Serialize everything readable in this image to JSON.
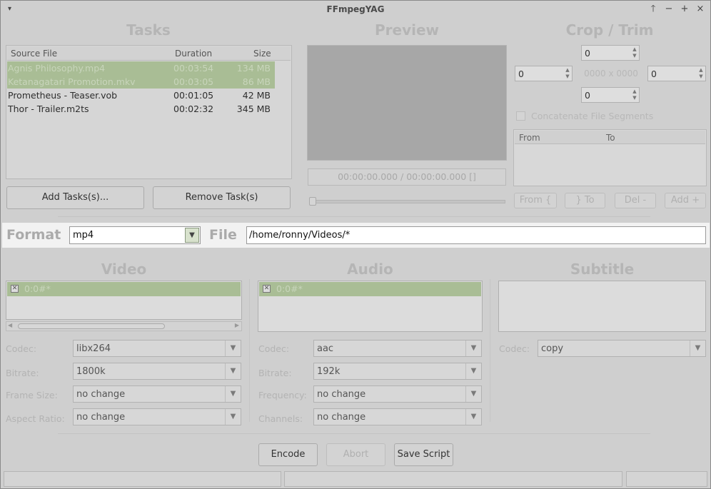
{
  "window": {
    "title": "FFmpegYAG",
    "menu_glyph": "▾",
    "buttons": [
      "🡑",
      "−",
      "+",
      "×"
    ]
  },
  "sections": {
    "tasks": "Tasks",
    "preview": "Preview",
    "crop_trim": "Crop / Trim",
    "video": "Video",
    "audio": "Audio",
    "subtitle": "Subtitle"
  },
  "tasks": {
    "columns": [
      "Source File",
      "Duration",
      "Size"
    ],
    "rows": [
      {
        "file": "Agnis Philosophy.mp4",
        "duration": "00:03:54",
        "size": "134 MB",
        "selected": true
      },
      {
        "file": "Ketanagatari Promotion.mkv",
        "duration": "00:03:05",
        "size": "86 MB",
        "selected": true
      },
      {
        "file": "Prometheus - Teaser.vob",
        "duration": "00:01:05",
        "size": "42 MB",
        "selected": false
      },
      {
        "file": "Thor - Trailer.m2ts",
        "duration": "00:02:32",
        "size": "345 MB",
        "selected": false
      }
    ],
    "add_label": "Add Tasks(s)...",
    "remove_label": "Remove Task(s)"
  },
  "preview": {
    "timecode": "00:00:00.000 / 00:00:00.000 []"
  },
  "crop": {
    "top": "0",
    "left": "0",
    "right": "0",
    "bottom": "0",
    "dimension": "0000 x 0000",
    "concat_label": "Concatenate File Segments",
    "columns": [
      "From",
      "To"
    ],
    "from_label": "From {",
    "to_label": "} To",
    "del_label": "Del -",
    "add_label": "Add +"
  },
  "format": {
    "label": "Format",
    "value": "mp4",
    "file_label": "File",
    "file_value": "/home/ronny/Videos/*"
  },
  "video": {
    "stream": "0:0#*",
    "codec_label": "Codec:",
    "codec": "libx264",
    "bitrate_label": "Bitrate:",
    "bitrate": "1800k",
    "framesize_label": "Frame Size:",
    "framesize": "no change",
    "aspect_label": "Aspect Ratio:",
    "aspect": "no change"
  },
  "audio": {
    "stream": "0:0#*",
    "codec_label": "Codec:",
    "codec": "aac",
    "bitrate_label": "Bitrate:",
    "bitrate": "192k",
    "frequency_label": "Frequency:",
    "frequency": "no change",
    "channels_label": "Channels:",
    "channels": "no change"
  },
  "subtitle": {
    "codec_label": "Codec:",
    "codec": "copy"
  },
  "actions": {
    "encode": "Encode",
    "abort": "Abort",
    "save_script": "Save Script"
  }
}
